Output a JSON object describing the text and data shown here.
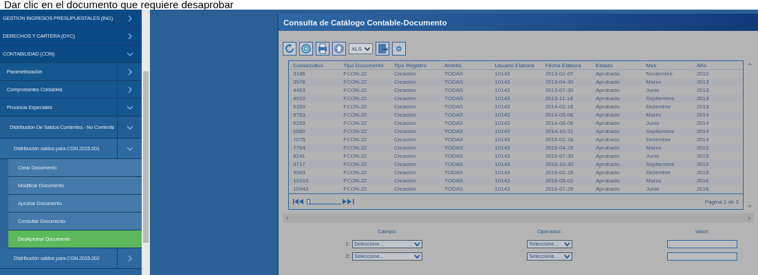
{
  "instruction": "Dar clic en el documento que requiere desaprobar",
  "sidebar": {
    "items": [
      {
        "label": "GESTION INGRESOS PRESUPUESTALES (ING)",
        "expanded": false,
        "selected": false
      },
      {
        "label": "DERECHOS Y CARTERA (DYC)",
        "expanded": false,
        "selected": false
      },
      {
        "label": "CONTABILIDAD (CON)",
        "expanded": true,
        "selected": false,
        "children": [
          {
            "label": "Parametrización",
            "expanded": false,
            "selected": false
          },
          {
            "label": "Comprobantes Contables",
            "expanded": false,
            "selected": false
          },
          {
            "label": "Procesos Especiales",
            "expanded": true,
            "selected": false,
            "children": [
              {
                "label": "Distribución De Saldos Corrientes - No Corriente",
                "expanded": true,
                "selected": false,
                "children": [
                  {
                    "label": "Distribución saldos para CGN.2015.001",
                    "expanded": true,
                    "selected": false,
                    "children": [
                      {
                        "label": "Crear Documento",
                        "selected": false
                      },
                      {
                        "label": "Modificar Documento",
                        "selected": false
                      },
                      {
                        "label": "Aprobar Documento",
                        "selected": false
                      },
                      {
                        "label": "Consultar Documento",
                        "selected": false
                      },
                      {
                        "label": "DesAprobar Documento",
                        "selected": true
                      }
                    ]
                  },
                  {
                    "label": "Distribución saldos para CGN.2015.002",
                    "expanded": false,
                    "selected": false
                  }
                ]
              }
            ]
          }
        ]
      }
    ]
  },
  "dialog": {
    "title": "Consulta de Catálogo Contable-Documento",
    "toolbar": {
      "format": "XLS"
    },
    "table": {
      "columns": [
        "Consecutivo",
        "Tipo Documento",
        "Tipo Registro",
        "Ambito",
        "Usuario Elabora",
        "Fecha Elabora",
        "Estado",
        "Mes",
        "Año"
      ],
      "rows": [
        [
          "3186",
          "FCON-22",
          "Creación",
          "TODAS",
          "10143",
          "2013-02-07",
          "Aprobado",
          "Noviembre",
          "2012"
        ],
        [
          "3976",
          "FCON-22",
          "Creación",
          "TODAS",
          "10143",
          "2013-04-30",
          "Aprobado",
          "Marzo",
          "2013"
        ],
        [
          "4463",
          "FCON-22",
          "Creación",
          "TODAS",
          "10143",
          "2013-07-30",
          "Aprobado",
          "Junio",
          "2013"
        ],
        [
          "4910",
          "FCON-22",
          "Creación",
          "TODAS",
          "10143",
          "2013-11-18",
          "Aprobado",
          "Septiembre",
          "2013"
        ],
        [
          "5359",
          "FCON-22",
          "Creación",
          "TODAS",
          "10143",
          "2014-02-18",
          "Aprobado",
          "Diciembre",
          "2013"
        ],
        [
          "5763",
          "FCON-22",
          "Creación",
          "TODAS",
          "10143",
          "2014-05-06",
          "Aprobado",
          "Marzo",
          "2014"
        ],
        [
          "6269",
          "FCON-22",
          "Creación",
          "TODAS",
          "10143",
          "2014-08-06",
          "Aprobado",
          "Junio",
          "2014"
        ],
        [
          "6660",
          "FCON-22",
          "Creación",
          "TODAS",
          "10143",
          "2014-10-31",
          "Aprobado",
          "Septiembre",
          "2014"
        ],
        [
          "7075",
          "FCON-22",
          "Creación",
          "TODAS",
          "10143",
          "2015-02-16",
          "Aprobado",
          "Diciembre",
          "2014"
        ],
        [
          "7764",
          "FCON-22",
          "Creación",
          "TODAS",
          "10143",
          "2015-04-29",
          "Aprobado",
          "Marzo",
          "2015"
        ],
        [
          "8241",
          "FCON-22",
          "Creación",
          "TODAS",
          "10143",
          "2015-07-30",
          "Aprobado",
          "Junio",
          "2015"
        ],
        [
          "8717",
          "FCON-22",
          "Creación",
          "TODAS",
          "10143",
          "2015-10-30",
          "Aprobado",
          "Septiembre",
          "2015"
        ],
        [
          "9083",
          "FCON-22",
          "Creación",
          "TODAS",
          "10143",
          "2016-02-15",
          "Aprobado",
          "Diciembre",
          "2015"
        ],
        [
          "10103",
          "FCON-22",
          "Creación",
          "TODAS",
          "10143",
          "2016-05-02",
          "Aprobado",
          "Marzo",
          "2016"
        ],
        [
          "10443",
          "FCON-22",
          "Creación",
          "TODAS",
          "10143",
          "2016-07-29",
          "Aprobado",
          "Junio",
          "2016"
        ]
      ]
    },
    "pager": {
      "level": 0,
      "page_info": "Página 1 de 3"
    },
    "filter": {
      "headers": [
        "Campo:",
        "Operador:",
        "Valor:"
      ],
      "rows": [
        {
          "index": "1:",
          "campo": "Seleccione...",
          "operador": "Seleccione..."
        },
        {
          "index": "2:",
          "campo": "Seleccione...",
          "operador": "Seleccione..."
        }
      ]
    }
  }
}
